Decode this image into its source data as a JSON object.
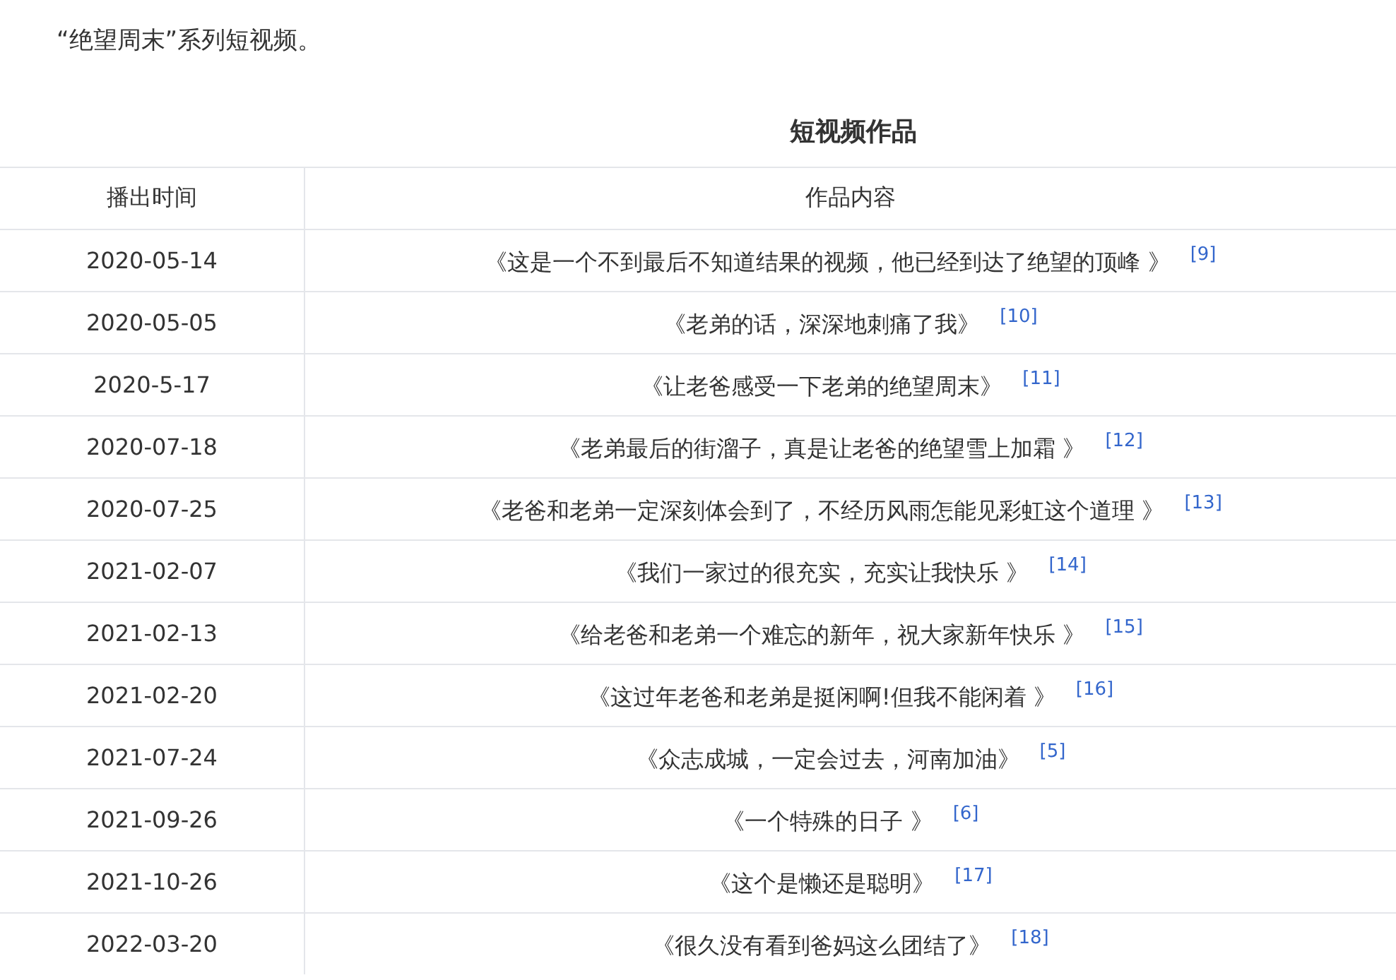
{
  "intro": "“绝望周末”系列短视频。",
  "table": {
    "caption": "短视频作品",
    "columns": [
      "播出时间",
      "作品内容"
    ],
    "rows": [
      {
        "date": "2020-05-14",
        "title": "《这是一个不到最后不知道结果的视频，他已经到达了绝望的顶峰 》",
        "ref": "[9]"
      },
      {
        "date": "2020-05-05",
        "title": "《老弟的话，深深地刺痛了我》",
        "ref": "[10]"
      },
      {
        "date": "2020-5-17",
        "title": "《让老爸感受一下老弟的绝望周末》",
        "ref": "[11]"
      },
      {
        "date": "2020-07-18",
        "title": "《老弟最后的街溜子，真是让老爸的绝望雪上加霜 》",
        "ref": "[12]"
      },
      {
        "date": "2020-07-25",
        "title": "《老爸和老弟一定深刻体会到了，不经历风雨怎能见彩虹这个道理 》",
        "ref": "[13]"
      },
      {
        "date": "2021-02-07",
        "title": "《我们一家过的很充实，充实让我快乐 》",
        "ref": "[14]"
      },
      {
        "date": "2021-02-13",
        "title": "《给老爸和老弟一个难忘的新年，祝大家新年快乐 》",
        "ref": "[15]"
      },
      {
        "date": "2021-02-20",
        "title": "《这过年老爸和老弟是挺闲啊!但我不能闲着 》",
        "ref": "[16]"
      },
      {
        "date": "2021-07-24",
        "title": "《众志成城，一定会过去，河南加油》",
        "ref": "[5]"
      },
      {
        "date": "2021-09-26",
        "title": "《一个特殊的日子 》",
        "ref": "[6]"
      },
      {
        "date": "2021-10-26",
        "title": "《这个是懒还是聪明》",
        "ref": "[17]"
      },
      {
        "date": "2022-03-20",
        "title": "《很久没有看到爸妈这么团结了》",
        "ref": "[18]"
      }
    ]
  }
}
